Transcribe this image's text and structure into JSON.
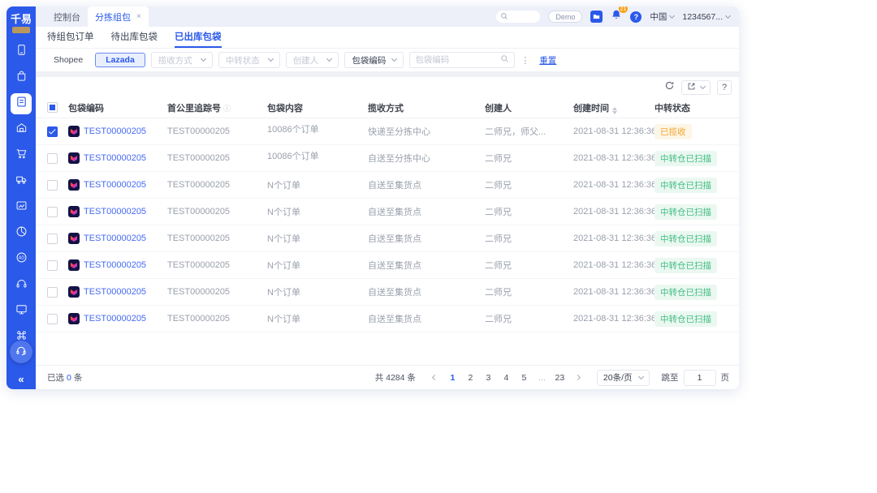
{
  "app": {
    "logo": "千易"
  },
  "topbar": {
    "tabs": [
      {
        "label": "控制台"
      },
      {
        "label": "分拣组包",
        "closable": true
      }
    ],
    "demo_label": "Demo",
    "notification_count": "21",
    "region": "中国",
    "account": "1234567..."
  },
  "subtabs": {
    "items": [
      {
        "label": "待组包订单"
      },
      {
        "label": "待出库包袋"
      },
      {
        "label": "已出库包袋",
        "active": true
      }
    ]
  },
  "filters": {
    "platforms": [
      {
        "label": "Shopee",
        "selected": false
      },
      {
        "label": "Lazada",
        "selected": true
      }
    ],
    "pickup_method": "揽收方式",
    "transit_status": "中转状态",
    "creator": "创建人",
    "search_type": "包袋编码",
    "search_placeholder": "包袋编码",
    "reset": "重置"
  },
  "table": {
    "columns": {
      "code": "包袋编码",
      "tracking": "首公里追踪号",
      "content": "包袋内容",
      "method": "揽收方式",
      "creator": "创建人",
      "time": "创建时间",
      "status": "中转状态"
    },
    "rows": [
      {
        "checked": true,
        "code": "TEST00000205",
        "tracking": "TEST00000205",
        "content": "10086个订单",
        "raised": true,
        "method": "快递至分拣中心",
        "creator": "二师兄，师父...",
        "time": "2021-08-31 12:36:36",
        "status": "已揽收",
        "status_type": "warning"
      },
      {
        "checked": false,
        "code": "TEST00000205",
        "tracking": "TEST00000205",
        "content": "10086个订单",
        "raised": true,
        "method": "自送至分拣中心",
        "creator": "二师兄",
        "time": "2021-08-31 12:36:36",
        "status": "中转仓已扫描",
        "status_type": "success"
      },
      {
        "checked": false,
        "code": "TEST00000205",
        "tracking": "TEST00000205",
        "content": "N个订单",
        "raised": false,
        "method": "自送至集货点",
        "creator": "二师兄",
        "time": "2021-08-31 12:36:36",
        "status": "中转仓已扫描",
        "status_type": "success"
      },
      {
        "checked": false,
        "code": "TEST00000205",
        "tracking": "TEST00000205",
        "content": "N个订单",
        "raised": false,
        "method": "自送至集货点",
        "creator": "二师兄",
        "time": "2021-08-31 12:36:36",
        "status": "中转仓已扫描",
        "status_type": "success"
      },
      {
        "checked": false,
        "code": "TEST00000205",
        "tracking": "TEST00000205",
        "content": "N个订单",
        "raised": false,
        "method": "自送至集货点",
        "creator": "二师兄",
        "time": "2021-08-31 12:36:36",
        "status": "中转仓已扫描",
        "status_type": "success"
      },
      {
        "checked": false,
        "code": "TEST00000205",
        "tracking": "TEST00000205",
        "content": "N个订单",
        "raised": false,
        "method": "自送至集货点",
        "creator": "二师兄",
        "time": "2021-08-31 12:36:36",
        "status": "中转仓已扫描",
        "status_type": "success"
      },
      {
        "checked": false,
        "code": "TEST00000205",
        "tracking": "TEST00000205",
        "content": "N个订单",
        "raised": false,
        "method": "自送至集货点",
        "creator": "二师兄",
        "time": "2021-08-31 12:36:36",
        "status": "中转仓已扫描",
        "status_type": "success"
      },
      {
        "checked": false,
        "code": "TEST00000205",
        "tracking": "TEST00000205",
        "content": "N个订单",
        "raised": false,
        "method": "自送至集货点",
        "creator": "二师兄",
        "time": "2021-08-31 12:36:36",
        "status": "中转仓已扫描",
        "status_type": "success"
      }
    ]
  },
  "footer": {
    "selected_prefix": "已选",
    "selected_count": "0",
    "selected_suffix": "条",
    "total": "共 4284 条",
    "pages": [
      "1",
      "2",
      "3",
      "4",
      "5",
      "...",
      "23"
    ],
    "active_page": "1",
    "page_size": "20条/页",
    "jump_label": "跳至",
    "jump_value": "1",
    "jump_unit": "页"
  },
  "colors": {
    "primary": "#2b59e9",
    "warning": "#f2a32c",
    "success": "#42bd83",
    "link": "#466af5"
  }
}
